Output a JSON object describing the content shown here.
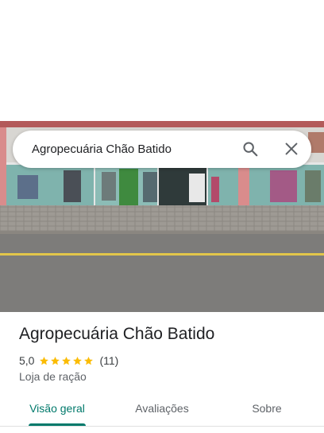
{
  "search": {
    "query": "Agropecuária Chão Batido"
  },
  "place": {
    "name": "Agropecuária Chão Batido",
    "rating": "5,0",
    "stars": 5,
    "review_count": "(11)",
    "category": "Loja de ração"
  },
  "tabs": [
    {
      "label": "Visão geral",
      "active": true
    },
    {
      "label": "Avaliações",
      "active": false
    },
    {
      "label": "Sobre",
      "active": false
    }
  ],
  "colors": {
    "accent": "#00796b",
    "star": "#fbbc04",
    "text_primary": "#202124",
    "text_secondary": "#5f6368"
  },
  "icons": [
    "search-icon",
    "close-icon",
    "star-icon"
  ]
}
